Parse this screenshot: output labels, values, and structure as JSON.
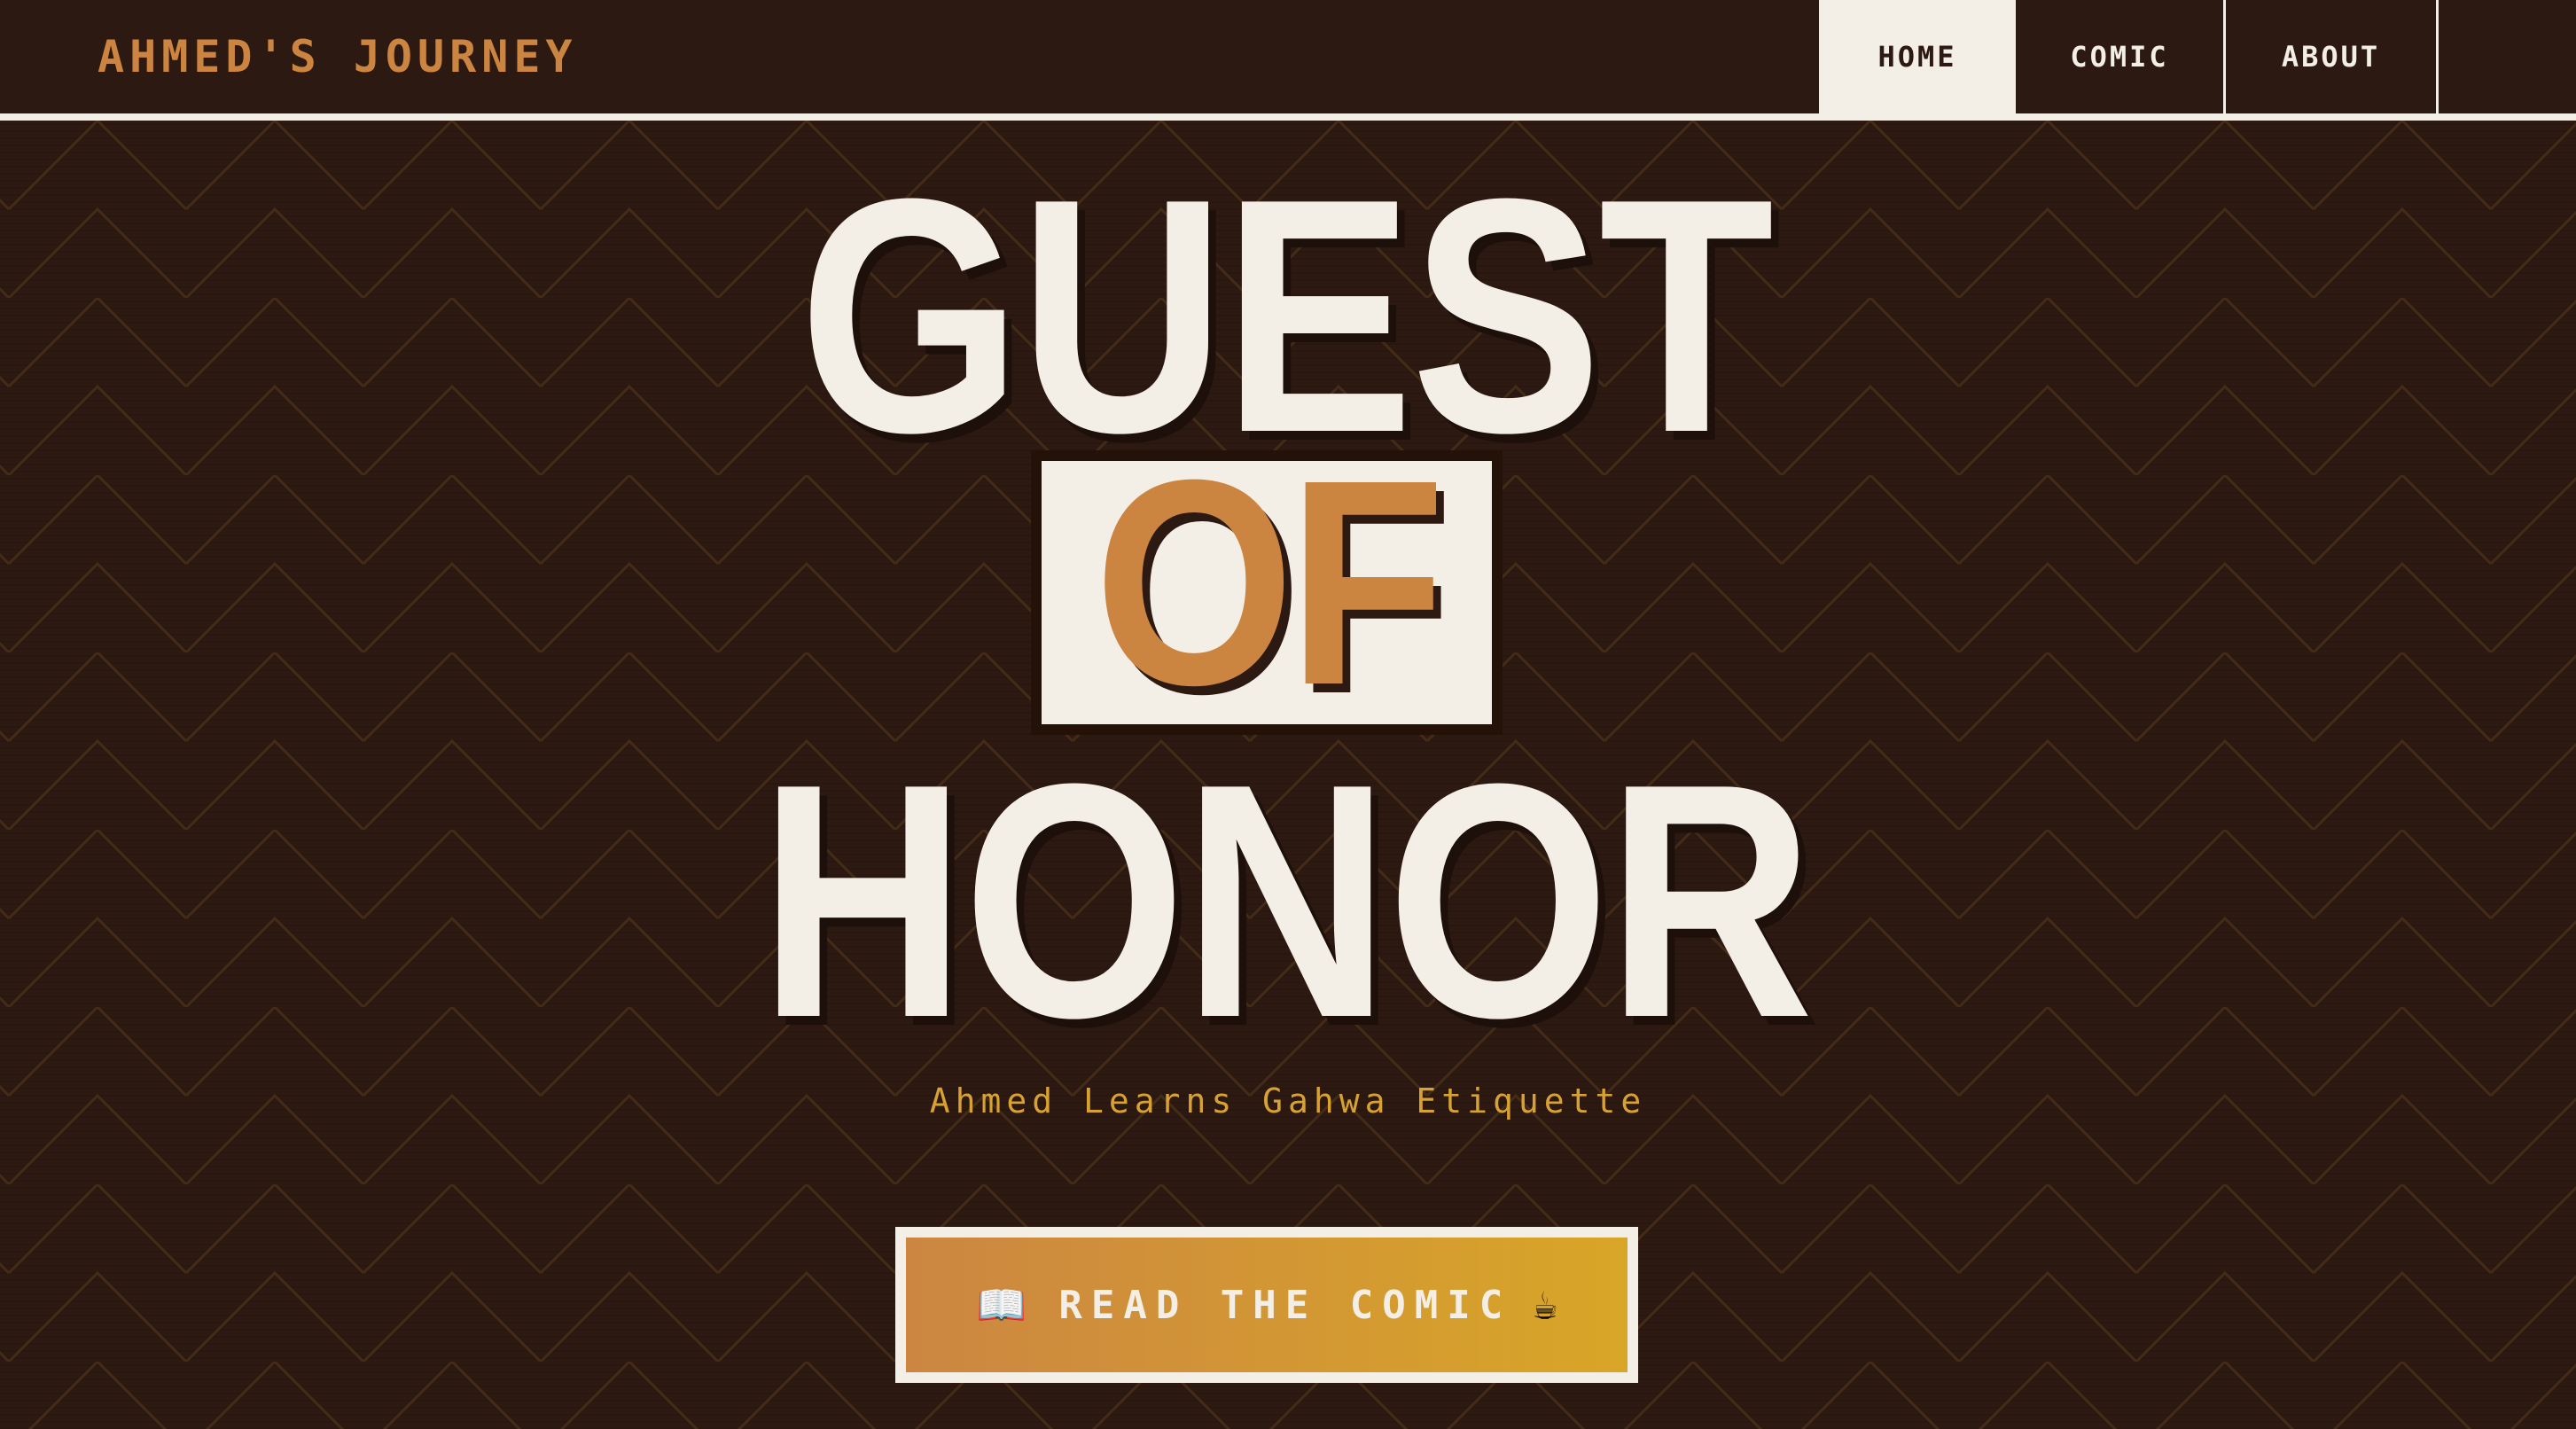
{
  "theme": {
    "background": "#2c1911",
    "cream": "#f4efe6",
    "accent": "#cc8540",
    "gold": "#d8a232"
  },
  "navbar": {
    "brand": "AHMED'S JOURNEY",
    "links": [
      {
        "label": "HOME",
        "active": true
      },
      {
        "label": "COMIC",
        "active": false
      },
      {
        "label": "ABOUT",
        "active": false
      }
    ]
  },
  "hero": {
    "title_top": "GUEST",
    "title_middle": "OF",
    "title_bottom": "HONOR",
    "subtitle": "Ahmed Learns Gahwa Etiquette",
    "cta": {
      "icon_left": "📖",
      "icon_left_name": "open-book-icon",
      "label": "READ THE COMIC",
      "icon_right": "☕",
      "icon_right_name": "coffee-cup-icon"
    }
  }
}
